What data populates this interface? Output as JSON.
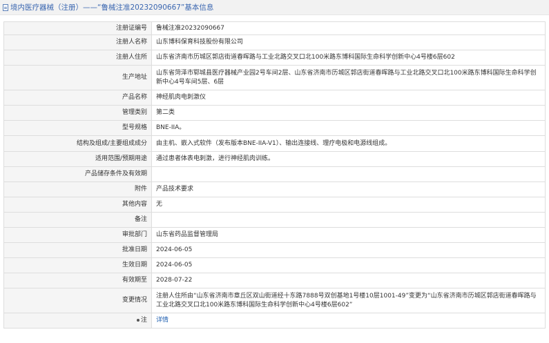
{
  "header": {
    "title": "境内医疗器械（注册）——“鲁械注准20232090667”基本信息",
    "icon": "document-icon"
  },
  "rows": [
    {
      "label": "注册证编号",
      "value": "鲁械注准20232090667"
    },
    {
      "label": "注册人名称",
      "value": "山东博科保育科技股份有限公司"
    },
    {
      "label": "注册人住所",
      "value": "山东省济南市历城区郭店街道春晖路与工业北路交叉口北100米路东博科国际生命科学创新中心4号楼6层602"
    },
    {
      "label": "生产地址",
      "value": "山东省菏泽市郓城县医疗器械产业园2号车间2层、山东省济南市历城区郭店街道春晖路与工业北路交叉口北100米路东博科国际生命科学创新中心4号车间5层、6层"
    },
    {
      "label": "产品名称",
      "value": "神经肌肉电刺激仪"
    },
    {
      "label": "管理类别",
      "value": "第二类"
    },
    {
      "label": "型号规格",
      "value": "BNE-IIA。"
    },
    {
      "label": "结构及组成/主要组成成分",
      "value": "由主机、嵌入式软件（发布版本BNE-IIA-V1）、输出连接线、理疗电极和电源线组成。"
    },
    {
      "label": "适用范围/预期用途",
      "value": "通过患者体表电刺激，进行神经肌肉训练。"
    },
    {
      "label": "产品储存条件及有效期",
      "value": ""
    },
    {
      "label": "附件",
      "value": "产品技术要求"
    },
    {
      "label": "其他内容",
      "value": "无"
    },
    {
      "label": "备注",
      "value": ""
    },
    {
      "label": "审批部门",
      "value": "山东省药品监督管理局"
    },
    {
      "label": "批准日期",
      "value": "2024-06-05"
    },
    {
      "label": "生效日期",
      "value": "2024-06-05"
    },
    {
      "label": "有效期至",
      "value": "2028-07-22"
    },
    {
      "label": "变更情况",
      "value": "注册人住所由“山东省济南市章丘区双山街道经十东路7888号双创基地1号楼10层1001-49”变更为“山东省济南市历城区郭店街道春晖路与工业北路交叉口北100米路东博科国际生命科学创新中心4号楼6层602”"
    }
  ],
  "note": {
    "label": "注",
    "value": "详情",
    "icon": "pin-icon"
  }
}
